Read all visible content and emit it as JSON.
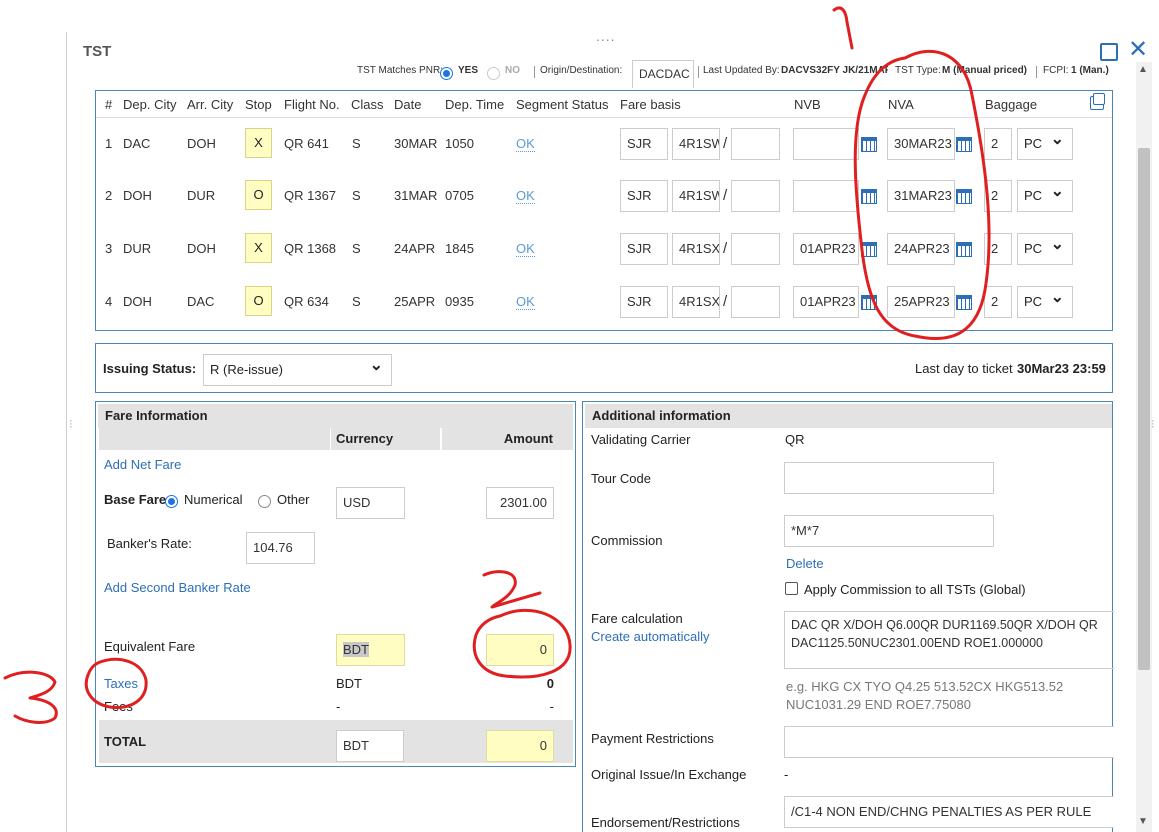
{
  "window": {
    "title": "TST",
    "maximize_icon": "maximize-icon",
    "close_glyph": "✕",
    "drag_handle": "....",
    "accent_color": "#2d6fb7"
  },
  "meta": {
    "tst_matches_label": "TST Matches PNR:",
    "yes": "YES",
    "no": "NO",
    "origin_label": "Origin/Destination:",
    "origin_value": "DACDAC",
    "last_updated_label": "Last Updated By:",
    "last_updated_value": "DACVS32FY JK/21MAR",
    "tst_type_label": "TST Type:",
    "tst_type_value": "M (Manual priced)",
    "fcpi_label": "FCPI:",
    "fcpi_value": "1 (Man.)"
  },
  "segments": {
    "headers": [
      "#",
      "Dep. City",
      "Arr. City",
      "Stop",
      "Flight No.",
      "Class",
      "Date",
      "Dep. Time",
      "Segment Status",
      "Fare basis",
      "NVB",
      "NVA",
      "Baggage"
    ],
    "rows": [
      {
        "num": "1",
        "dep": "DAC",
        "arr": "DOH",
        "stop": "X",
        "flight": "QR 641",
        "class": "S",
        "date": "30MAR",
        "time": "1050",
        "status": "OK",
        "fb1": "SJR",
        "fb2": "4R1SW",
        "slash": "/",
        "fb3": "",
        "nvb": "",
        "nva": "30MAR23",
        "bag_qty": "2",
        "bag_unit": "PC"
      },
      {
        "num": "2",
        "dep": "DOH",
        "arr": "DUR",
        "stop": "O",
        "flight": "QR 1367",
        "class": "S",
        "date": "31MAR",
        "time": "0705",
        "status": "OK",
        "fb1": "SJR",
        "fb2": "4R1SW",
        "slash": "/",
        "fb3": "",
        "nvb": "",
        "nva": "31MAR23",
        "bag_qty": "2",
        "bag_unit": "PC"
      },
      {
        "num": "3",
        "dep": "DUR",
        "arr": "DOH",
        "stop": "X",
        "flight": "QR 1368",
        "class": "S",
        "date": "24APR",
        "time": "1845",
        "status": "OK",
        "fb1": "SJR",
        "fb2": "4R1SX",
        "slash": "/",
        "fb3": "",
        "nvb": "01APR23",
        "nva": "24APR23",
        "bag_qty": "2",
        "bag_unit": "PC"
      },
      {
        "num": "4",
        "dep": "DOH",
        "arr": "DAC",
        "stop": "O",
        "flight": "QR 634",
        "class": "S",
        "date": "25APR",
        "time": "0935",
        "status": "OK",
        "fb1": "SJR",
        "fb2": "4R1SX",
        "slash": "/",
        "fb3": "",
        "nvb": "01APR23",
        "nva": "25APR23",
        "bag_qty": "2",
        "bag_unit": "PC"
      }
    ]
  },
  "issuing": {
    "label": "Issuing Status:",
    "value": "R (Re-issue)",
    "last_day_label": "Last day to ticket",
    "last_day_value": "30Mar23 23:59"
  },
  "fare": {
    "title": "Fare Information",
    "currency_header": "Currency",
    "amount_header": "Amount",
    "add_net_fare": "Add Net Fare",
    "base_fare_label": "Base Fare",
    "numerical": "Numerical",
    "other": "Other",
    "base_currency": "USD",
    "base_amount": "2301.00",
    "bankers_rate_label": "Banker's Rate:",
    "bankers_rate": "104.76",
    "add_second_banker": "Add Second Banker Rate",
    "equiv_label": "Equivalent Fare",
    "equiv_currency": "BDT",
    "equiv_amount": "0",
    "taxes_label": "Taxes",
    "taxes_currency": "BDT",
    "taxes_amount": "0",
    "fees_label": "Fees",
    "fees_currency": "-",
    "fees_amount": "-",
    "total_label": "TOTAL",
    "total_currency": "BDT",
    "total_amount": "0"
  },
  "additional": {
    "title": "Additional information",
    "validating_label": "Validating Carrier",
    "validating_value": "QR",
    "tour_code_label": "Tour Code",
    "tour_code_value": "",
    "commission_label": "Commission",
    "commission_value": "*M*7",
    "delete": "Delete",
    "apply_commission": "Apply Commission to  all TSTs (Global)",
    "fare_calc_label": "Fare calculation",
    "create_auto": "Create automatically",
    "fare_calc_line1": "DAC QR X/DOH Q6.00QR DUR1169.50QR X/DOH QR",
    "fare_calc_line2": "DAC1125.50NUC2301.00END ROE1.000000",
    "example_line1": "e.g. HKG CX TYO Q4.25 513.52CX HKG513.52",
    "example_line2": "NUC1031.29 END ROE7.75080",
    "payment_label": "Payment Restrictions",
    "payment_value": "",
    "orig_issue_label": "Original Issue/In Exchange",
    "orig_issue_value": "-",
    "endorsement_label": "Endorsement/Restrictions",
    "endorsement_value": "/C1-4 NON END/CHNG PENALTIES AS PER RULE"
  },
  "annotations": {
    "color": "#e02020",
    "label_1": "1",
    "label_2": "2",
    "label_3": "3"
  }
}
